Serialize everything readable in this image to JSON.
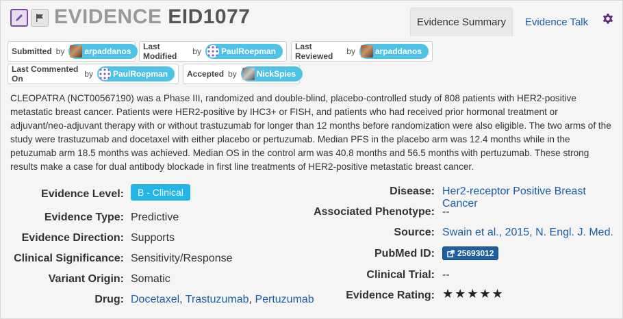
{
  "header": {
    "title_prefix": "EVIDENCE",
    "title_id": "EID1077",
    "tabs": [
      {
        "label": "Evidence Summary",
        "active": true
      },
      {
        "label": "Evidence Talk",
        "active": false
      }
    ]
  },
  "attributions": {
    "submitted": {
      "label": "Submitted",
      "by": "by",
      "user": "arpaddanos"
    },
    "last_modified": {
      "label": "Last Modified",
      "by": "by",
      "user": "PaulRoepman"
    },
    "last_reviewed": {
      "label": "Last Reviewed",
      "by": "by",
      "user": "arpaddanos"
    },
    "last_commented": {
      "label": "Last Commented On",
      "by": "by",
      "user": "PaulRoepman"
    },
    "accepted": {
      "label": "Accepted",
      "by": "by",
      "user": "NickSpies"
    }
  },
  "description": "CLEOPATRA (NCT00567190) was a Phase III, randomized and double-blind, placebo-controlled study of 808 patients with HER2-positive metastatic breast cancer. Patients were HER2-positive by IHC3+ or FISH, and patients who had received prior hormonal treatment or adjuvant/neo-adjuvant therapy with or without trastuzumab for longer than 12 months before randomization were also eligible. The two arms of the study were trastuzumab and docetaxel with either placebo or pertuzumab. Median PFS in the placebo arm was 12.4 months while in the petuzumab arm 18.5 months was achieved. Median OS in the control arm was 40.8 months and 56.5 months with pertuzumab. These strong results make a case for dual antibody blockade in first line treatments of HER2-positive metastatic breast cancer.",
  "left_fields": {
    "evidence_level": {
      "label": "Evidence Level:",
      "value": "B - Clinical"
    },
    "evidence_type": {
      "label": "Evidence Type:",
      "value": "Predictive"
    },
    "evidence_direction": {
      "label": "Evidence Direction:",
      "value": "Supports"
    },
    "clinical_significance": {
      "label": "Clinical Significance:",
      "value": "Sensitivity/Response"
    },
    "variant_origin": {
      "label": "Variant Origin:",
      "value": "Somatic"
    },
    "drug": {
      "label": "Drug:",
      "drugs": [
        "Docetaxel",
        "Trastuzumab",
        "Pertuzumab"
      ],
      "separator": ", "
    }
  },
  "right_fields": {
    "disease": {
      "label": "Disease:",
      "value": "Her2-receptor Positive Breast Cancer"
    },
    "associated_phenotype": {
      "label": "Associated Phenotype:",
      "value": "--"
    },
    "source": {
      "label": "Source:",
      "value": "Swain et al., 2015, N. Engl. J. Med."
    },
    "pubmed": {
      "label": "PubMed ID:",
      "value": "25693012"
    },
    "clinical_trial": {
      "label": "Clinical Trial:",
      "value": "--"
    },
    "evidence_rating": {
      "label": "Evidence Rating:",
      "value": "★★★★★",
      "rating": 5,
      "max": 5
    }
  },
  "colors": {
    "accent_link": "#1a5fa6",
    "user_pill": "#4fc3e6",
    "level_badge": "#23b5e6",
    "pubmed_badge": "#1f5f9e",
    "edit_icon": "#7a4aa0"
  },
  "icons": [
    "edit-icon",
    "flag-icon",
    "gear-icon",
    "external-link-icon"
  ]
}
